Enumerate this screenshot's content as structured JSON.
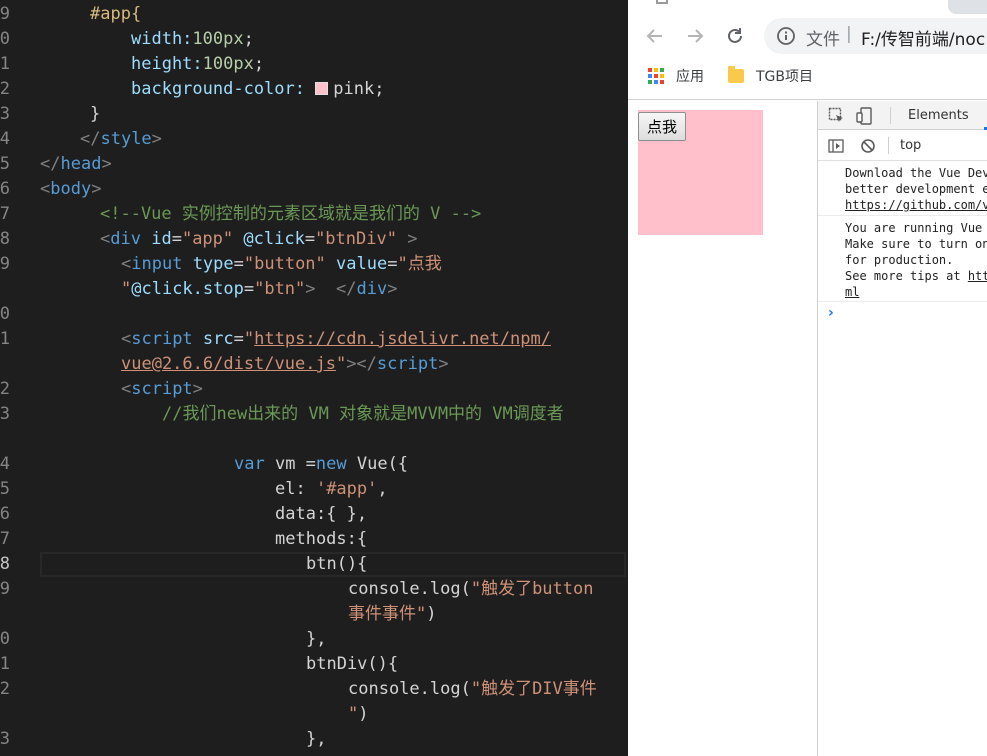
{
  "editor": {
    "gutter_numbers": [
      "9",
      "0",
      "1",
      "2",
      "3",
      "4",
      "5",
      "6",
      "7",
      "8",
      "9",
      "0",
      "1",
      "2",
      "3",
      "",
      "4",
      "5",
      "6",
      "7",
      "8",
      "9",
      "",
      "0",
      "1",
      "2",
      "",
      "3"
    ],
    "css_block": {
      "selector": "#app{",
      "width_prop": "width:",
      "width_val": "100px",
      "width_end": ";",
      "height_prop": "height:",
      "height_val": "100px",
      "height_end": ";",
      "bg_prop": "background-color: ",
      "bg_val": "pink",
      "bg_end": ";",
      "close_brace": "}"
    },
    "style_close": "style",
    "head_close": "head",
    "body_open": "body",
    "comment_line": "<!--Vue 实例控制的元素区域就是我们的 V -->",
    "div_line": {
      "tag": "div",
      "attr_id": "id",
      "eq1": "=",
      "val_id": "\"app\"",
      "attr_click": "@click",
      "eq2": "=",
      "val_click": "\"btnDiv\""
    },
    "input_line": {
      "tag": "input",
      "attr_type": "type",
      "eq1": "=",
      "val_type": "\"button\"",
      "attr_value": "value",
      "eq2": "=",
      "val_value_1": "\"点我",
      "val_value_2": "\"",
      "attr_stop": "@click.stop",
      "eq3": "=",
      "val_stop": "\"btn\"",
      "close_div": "div"
    },
    "script_src_line": {
      "tag": "script",
      "attr_src": "src",
      "eq": "=",
      "q": "\"",
      "url_1": "https://cdn.jsdelivr.net/npm/",
      "url_2": "vue@2.6.6/dist/vue.js",
      "close_tag": "script"
    },
    "script_open": "script",
    "js_comment": "//我们new出来的 VM 对象就是MVVM中的 VM调度者",
    "js": {
      "var_kw": "var",
      "vm": " vm =",
      "new_kw": "new",
      "vue_call": " Vue({",
      "el_key": "el: ",
      "el_val": "'#app'",
      "el_end": ",",
      "data_line": "data:{ },",
      "methods_line": "methods:{",
      "btn_fn": "btn(){",
      "log1_call": "console.log(",
      "log1_str_1": "\"触发了button",
      "log1_str_2": "事件事件\"",
      "log1_end": ")",
      "btn_close": "},",
      "btndiv_fn": "btnDiv(){",
      "log2_call": "console.log(",
      "log2_str_1": "\"触发了DIV事件",
      "log2_str_2": "\"",
      "log2_end": ")",
      "btndiv_close": "},"
    }
  },
  "browser": {
    "omnibox": {
      "scheme_label": "文件",
      "separator": "|",
      "url_text": "F:/传智前端/noc"
    },
    "bookmarks": [
      {
        "label": "应用"
      },
      {
        "label": "TGB项目"
      }
    ],
    "page": {
      "button_label": "点我",
      "box_color": "#ffc0cb"
    }
  },
  "devtools": {
    "tab_elements": "Elements",
    "context_label": "top",
    "messages": [
      {
        "lines": [
          "Download the Vue Dev",
          "better development e"
        ],
        "link": "https://github.com/v"
      },
      {
        "lines": [
          "You are running Vue",
          "Make sure to turn on",
          "for production.",
          "See more tips at "
        ],
        "link_1": "htt",
        "link_2": "ml"
      }
    ],
    "prompt_glyph": "›"
  },
  "colors": {
    "pink": "#ffc0cb",
    "editor_bg": "#1e1e1e",
    "tag_blue": "#569cd6",
    "string_orange": "#ce9178",
    "comment_green": "#6a9955"
  }
}
